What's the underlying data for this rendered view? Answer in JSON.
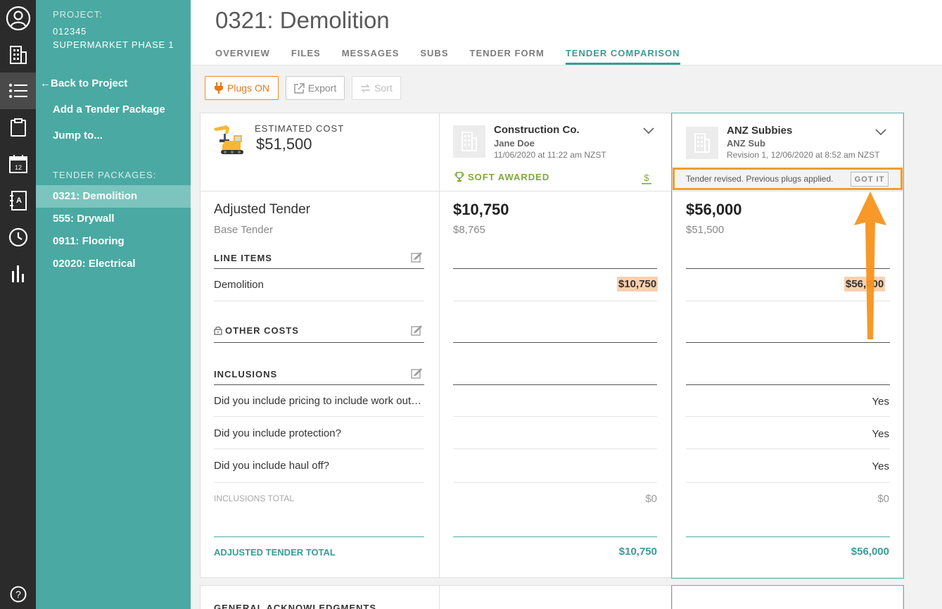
{
  "rail": {
    "icons": [
      "user-icon",
      "building-icon",
      "list-icon",
      "clipboard-icon",
      "calendar-icon",
      "contacts-icon",
      "clock-icon",
      "bar-chart-icon",
      "help-icon"
    ],
    "calendar_day": "12",
    "help_glyph": "?"
  },
  "sidebar": {
    "project_label": "PROJECT:",
    "project_number": "012345",
    "project_name": "SUPERMARKET PHASE 1",
    "back_link": "Back to Project",
    "add_package": "Add a Tender Package",
    "jump_to": "Jump to...",
    "section_label": "TENDER PACKAGES:",
    "packages": [
      "0321: Demolition",
      "555: Drywall",
      "0911: Flooring",
      "02020: Electrical"
    ],
    "active_package": "0321: Demolition"
  },
  "header": {
    "title": "0321: Demolition",
    "tabs": [
      "OVERVIEW",
      "FILES",
      "MESSAGES",
      "SUBS",
      "TENDER FORM",
      "TENDER COMPARISON"
    ],
    "active_tab": "TENDER COMPARISON"
  },
  "toolbar": {
    "plugs_label": "Plugs ON",
    "export_label": "Export",
    "sort_label": "Sort"
  },
  "estimate": {
    "label": "ESTIMATED COST",
    "value": "$51,500"
  },
  "companies": [
    {
      "name": "Construction Co.",
      "contact": "Jane Doe",
      "date": "11/06/2020 at 11:22 am NZST",
      "status": "SOFT AWARDED",
      "adjusted": "$10,750",
      "base": "$8,765",
      "demolition": "$10,750",
      "answers": [
        "",
        "",
        ""
      ],
      "inclusions_total": "$0",
      "total": "$10,750"
    },
    {
      "name": "ANZ Subbies",
      "contact": "ANZ Sub",
      "date": "Revision 1, 12/06/2020 at 8:52 am NZST",
      "notice": "Tender revised. Previous plugs applied.",
      "notice_button": "GOT IT",
      "adjusted": "$56,000",
      "base": "$51,500",
      "demolition": "$56,000",
      "answers": [
        "Yes",
        "Yes",
        "Yes"
      ],
      "inclusions_total": "$0",
      "total": "$56,000"
    }
  ],
  "rows": {
    "adjusted_tender": "Adjusted Tender",
    "base_tender": "Base Tender",
    "line_items": "LINE ITEMS",
    "demolition": "Demolition",
    "other_costs": "OTHER COSTS",
    "inclusions": "INCLUSIONS",
    "questions": [
      "Did you include pricing to include work outside normal hours?",
      "Did you include protection?",
      "Did you include haul off?"
    ],
    "inclusions_total": "INCLUSIONS TOTAL",
    "adjusted_total": "ADJUSTED TENDER TOTAL",
    "general_ack": "GENERAL ACKNOWLEDGMENTS"
  },
  "colors": {
    "teal": "#4aa9a2",
    "orange": "#f39c2b",
    "plug_highlight": "#fbd0ad",
    "awarded_green": "#7da83c"
  }
}
